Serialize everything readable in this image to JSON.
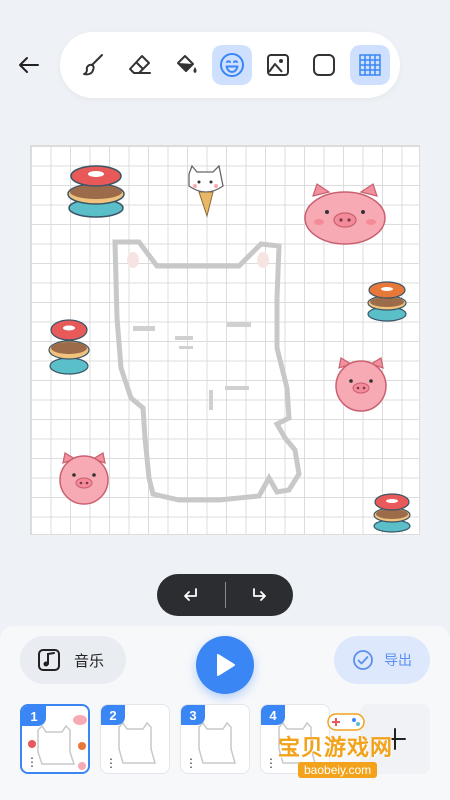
{
  "toolbar": {
    "tools": [
      {
        "name": "brush-icon",
        "active": false
      },
      {
        "name": "eraser-icon",
        "active": false
      },
      {
        "name": "fill-bucket-icon",
        "active": false
      },
      {
        "name": "sticker-smiley-icon",
        "active": true
      },
      {
        "name": "image-icon",
        "active": false
      },
      {
        "name": "shape-square-icon",
        "active": false
      },
      {
        "name": "grid-icon",
        "active": true
      }
    ]
  },
  "controls": {
    "music_label": "音乐",
    "export_label": "导出"
  },
  "frames": [
    {
      "number": "1",
      "more": "⋮",
      "active": true
    },
    {
      "number": "2",
      "more": "⋮",
      "active": false
    },
    {
      "number": "3",
      "more": "⋮",
      "active": false
    },
    {
      "number": "4",
      "more": "⋮",
      "active": false
    }
  ],
  "watermark": {
    "text": "宝贝游戏网",
    "url": "baobeiy.com"
  },
  "colors": {
    "accent": "#3a86f5",
    "accent_light": "#cfe0ff",
    "dark_pill": "#2b2d31",
    "pig_pink": "#f7a9b4",
    "watermark_orange": "#f2a31b"
  }
}
